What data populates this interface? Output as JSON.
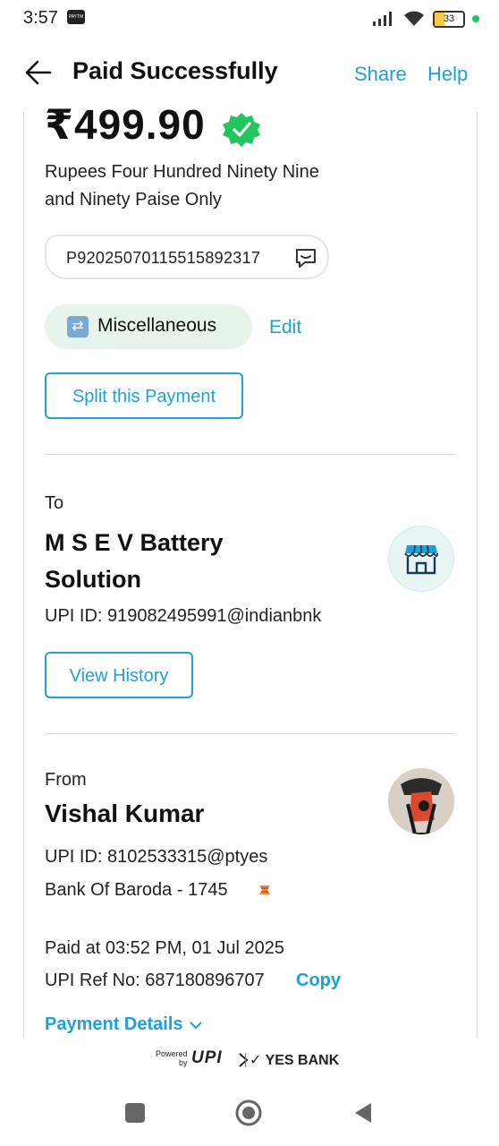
{
  "status_bar": {
    "time": "3:57",
    "app_badge": "PAYTM",
    "battery": "33"
  },
  "header": {
    "title": "Paid Successfully",
    "share": "Share",
    "help": "Help"
  },
  "payment": {
    "amount": "₹499.90",
    "amount_words_line1": "Rupees Four Hundred Ninety Nine",
    "amount_words_line2": "and Ninety Paise Only",
    "transaction_id": "P92025070115515892317",
    "category": "Miscellaneous",
    "edit_label": "Edit",
    "split_label": "Split this Payment"
  },
  "to": {
    "label": "To",
    "name_line1": "M S E V Battery",
    "name_line2": "Solution",
    "upi_id": "UPI ID: 919082495991@indianbnk",
    "history_label": "View History"
  },
  "from": {
    "label": "From",
    "name": "Vishal Kumar",
    "upi_id": "UPI ID: 8102533315@ptyes",
    "bank": "Bank Of Baroda - 1745"
  },
  "details": {
    "paid_at": "Paid at 03:52 PM, 01 Jul 2025",
    "ref_no": "UPI Ref No: 687180896707",
    "copy_label": "Copy",
    "payment_details_label": "Payment Details"
  },
  "footer": {
    "powered_by_line1": "Powered",
    "powered_by_line2": "by",
    "upi_logo": "UPI",
    "bank_partner": "YES BANK"
  },
  "colors": {
    "accent": "#1da1d8",
    "success": "#22c55e",
    "category_bg": "#e6f4ec"
  }
}
